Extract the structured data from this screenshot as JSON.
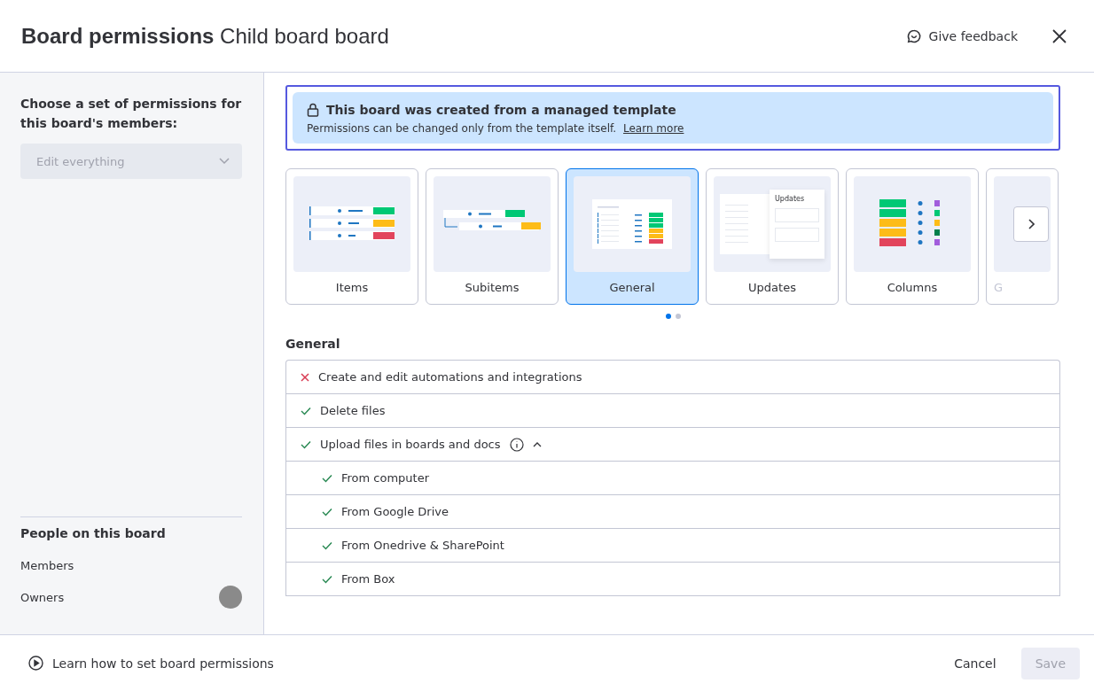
{
  "header": {
    "title": "Board permissions",
    "subtitle": "Child board board",
    "feedback": "Give feedback"
  },
  "sidebar": {
    "prompt": "Choose a set of permissions for this board's members:",
    "dropdown": {
      "value": "Edit everything",
      "disabled": true
    },
    "people_heading": "People on this board",
    "people": [
      {
        "label": "Members",
        "has_avatar": false
      },
      {
        "label": "Owners",
        "has_avatar": true
      }
    ]
  },
  "banner": {
    "title": "This board was created from a managed template",
    "text": "Permissions can be changed only from the template itself.",
    "link": "Learn more"
  },
  "categories": [
    {
      "label": "Items",
      "kind": "items",
      "selected": false
    },
    {
      "label": "Subitems",
      "kind": "subitems",
      "selected": false
    },
    {
      "label": "General",
      "kind": "general",
      "selected": true
    },
    {
      "label": "Updates",
      "kind": "updates",
      "selected": false,
      "thumbnail_text": "Updates"
    },
    {
      "label": "Columns",
      "kind": "columns",
      "selected": false
    },
    {
      "label": "G",
      "kind": "partial",
      "selected": false
    }
  ],
  "pager": [
    {
      "selected": true
    },
    {
      "selected": false
    }
  ],
  "section_title": "General",
  "permissions": [
    {
      "label": "Create and edit automations and integrations",
      "allowed": false
    },
    {
      "label": "Delete files",
      "allowed": true
    },
    {
      "label": "Upload files in boards and docs",
      "allowed": true,
      "info": true,
      "expanded": true,
      "children": [
        {
          "label": "From computer",
          "allowed": true
        },
        {
          "label": "From Google Drive",
          "allowed": true
        },
        {
          "label": "From Onedrive & SharePoint",
          "allowed": true
        },
        {
          "label": "From Box",
          "allowed": true
        }
      ]
    }
  ],
  "footer": {
    "tutorial": "Learn how to set board permissions",
    "cancel": "Cancel",
    "save": "Save",
    "save_disabled": true
  }
}
